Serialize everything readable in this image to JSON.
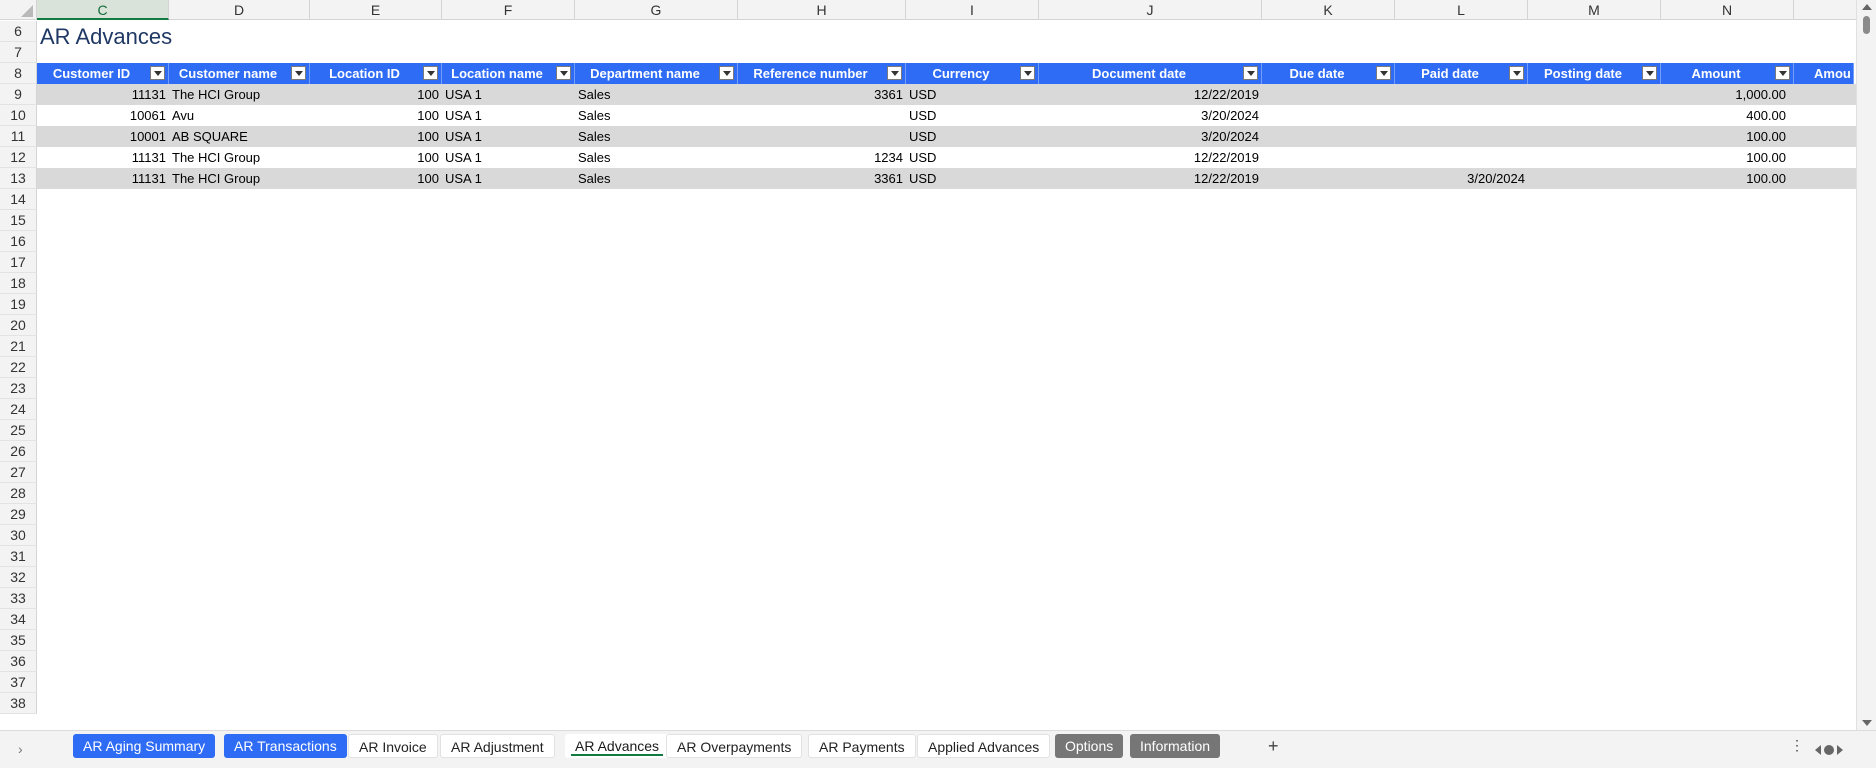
{
  "sheet": {
    "title": "AR Advances",
    "columns": [
      "C",
      "D",
      "E",
      "F",
      "G",
      "H",
      "I",
      "J",
      "K",
      "L",
      "M",
      "N"
    ],
    "selected_column": "C",
    "rows": [
      "6",
      "7",
      "8",
      "9",
      "10",
      "11",
      "12",
      "13",
      "14",
      "15",
      "16",
      "17",
      "18",
      "19",
      "20",
      "21",
      "22",
      "23",
      "24",
      "25",
      "26",
      "27",
      "28",
      "29",
      "30",
      "31",
      "32",
      "33",
      "34",
      "35",
      "36",
      "37",
      "38"
    ],
    "table_headers": [
      "Customer ID",
      "Customer name",
      "Location ID",
      "Location name",
      "Department name",
      "Reference number",
      "Currency",
      "Document date",
      "Due date",
      "Paid date",
      "Posting date",
      "Amount",
      "Amou"
    ],
    "table_rows": [
      [
        "11131",
        "The HCI Group",
        "100",
        "USA 1",
        "Sales",
        "3361",
        "USD",
        "12/22/2019",
        "",
        "",
        "",
        "1,000.00",
        ""
      ],
      [
        "10061",
        "Avu",
        "100",
        "USA 1",
        "Sales",
        "",
        "USD",
        "3/20/2024",
        "",
        "",
        "",
        "400.00",
        ""
      ],
      [
        "10001",
        "AB SQUARE",
        "100",
        "USA 1",
        "Sales",
        "",
        "USD",
        "3/20/2024",
        "",
        "",
        "",
        "100.00",
        ""
      ],
      [
        "11131",
        "The HCI Group",
        "100",
        "USA 1",
        "Sales",
        "1234",
        "USD",
        "12/22/2019",
        "",
        "",
        "",
        "100.00",
        ""
      ],
      [
        "11131",
        "The HCI Group",
        "100",
        "USA 1",
        "Sales",
        "3361",
        "USD",
        "12/22/2019",
        "",
        "3/20/2024",
        "",
        "100.00",
        ""
      ]
    ],
    "header_color": "#2f6cf5",
    "band_color": "#d9d9d9"
  },
  "tabs": [
    {
      "label": "AR Aging Summary",
      "style": "blue"
    },
    {
      "label": "AR Transactions",
      "style": "blue"
    },
    {
      "label": "AR Invoice",
      "style": "plain"
    },
    {
      "label": "AR Adjustment",
      "style": "plain"
    },
    {
      "label": "AR Advances",
      "style": "active"
    },
    {
      "label": "AR Overpayments",
      "style": "plain"
    },
    {
      "label": "AR Payments",
      "style": "plain"
    },
    {
      "label": "Applied Advances",
      "style": "plain"
    },
    {
      "label": "Options",
      "style": "gray"
    },
    {
      "label": "Information",
      "style": "gray"
    }
  ],
  "tabbar": {
    "add_label": "+",
    "more_label": "⋮",
    "nav_label": "›"
  },
  "icons": [
    "select-all-icon",
    "filter-dropdown-icon",
    "add-sheet-icon",
    "more-options-icon",
    "scroll-left-icon",
    "scroll-right-icon"
  ]
}
